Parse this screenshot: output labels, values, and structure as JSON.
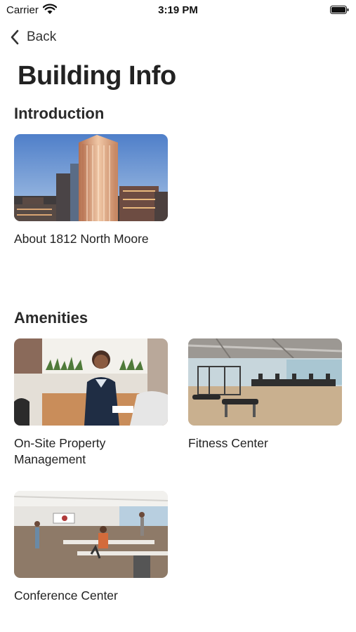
{
  "status_bar": {
    "carrier": "Carrier",
    "time": "3:19 PM",
    "wifi_icon": "wifi-icon",
    "battery_icon": "battery-full-icon"
  },
  "nav": {
    "back_label": "Back",
    "back_icon": "chevron-left-icon"
  },
  "page": {
    "title": "Building Info"
  },
  "sections": {
    "introduction": {
      "title": "Introduction",
      "items": [
        {
          "label": "About 1812 North Moore"
        }
      ]
    },
    "amenities": {
      "title": "Amenities",
      "items": [
        {
          "label": "On-Site Property Management"
        },
        {
          "label": "Fitness Center"
        },
        {
          "label": "Conference Center"
        }
      ]
    }
  }
}
